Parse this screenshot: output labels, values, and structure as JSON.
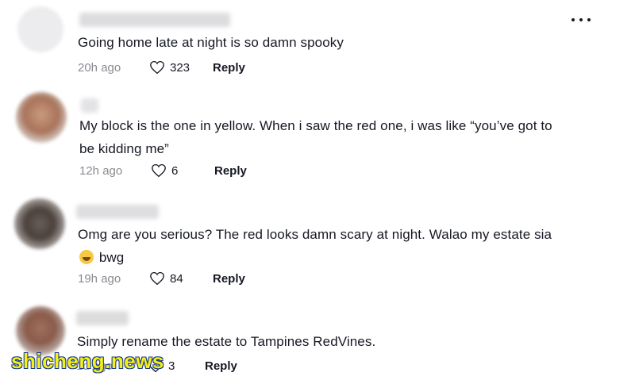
{
  "comments": [
    {
      "text": "Going home late at night is so damn spooky",
      "time": "20h ago",
      "likes": "323",
      "reply": "Reply"
    },
    {
      "text": "My block is the one in yellow. When i saw the red one, i was like “you’ve got to be kidding me”",
      "time": "12h ago",
      "likes": "6",
      "reply": "Reply"
    },
    {
      "text_before_emoji": "Omg are you serious? The red looks damn scary at night. Walao my estate sia",
      "text_after_emoji": "bwg",
      "time": "19h ago",
      "likes": "84",
      "reply": "Reply"
    },
    {
      "text": "Simply rename the estate to Tampines RedVines.",
      "time": "1d ago",
      "likes": "3",
      "reply": "Reply"
    }
  ],
  "watermark": "shicheng.news",
  "icons": {
    "more": "more-options-icon",
    "like": "heart-outline-icon",
    "emoji": "laughing-emoji-icon"
  }
}
